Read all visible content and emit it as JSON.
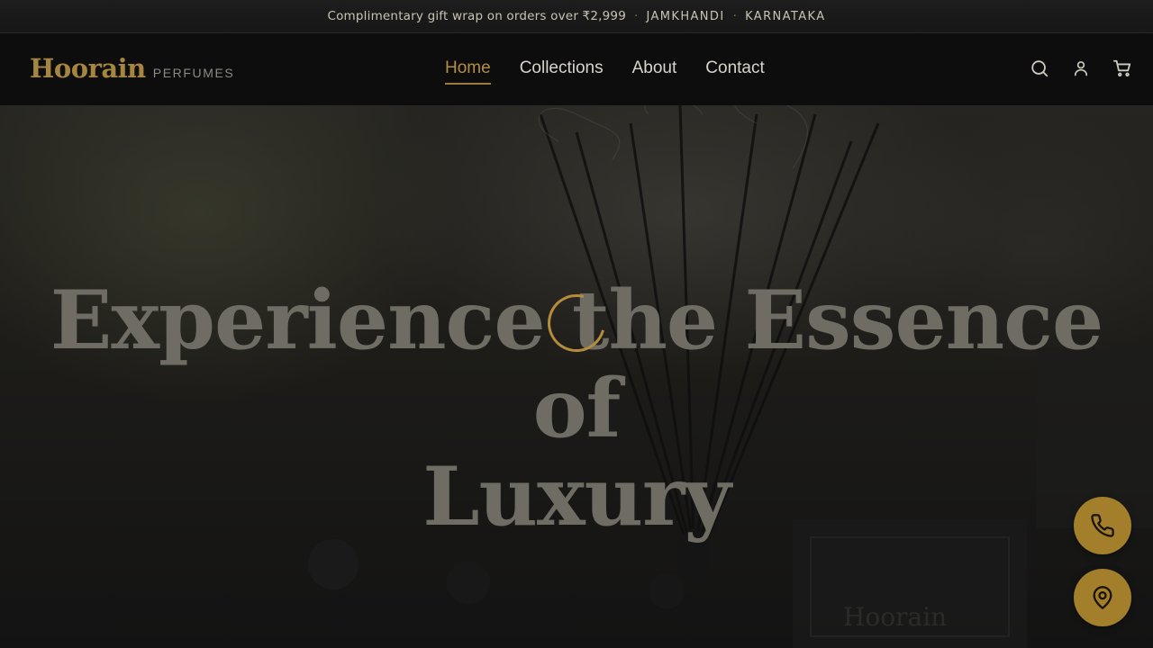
{
  "announcement": {
    "offer": "Complimentary gift wrap on orders over ₹2,999",
    "separator": "·",
    "city": "JAMKHANDI",
    "state": "KARNATAKA"
  },
  "brand": {
    "name": "Hoorain",
    "subtitle": "PERFUMES",
    "color": "#a5853f"
  },
  "nav": {
    "items": [
      {
        "label": "Home",
        "active": true
      },
      {
        "label": "Collections",
        "active": false
      },
      {
        "label": "About",
        "active": false
      },
      {
        "label": "Contact",
        "active": false
      }
    ]
  },
  "header_icons": [
    "search-icon",
    "account-icon",
    "cart-icon"
  ],
  "hero": {
    "headline_line1": "Experience the Essence of",
    "headline_line2": "Luxury",
    "watermark": "Hoorain",
    "loading": true
  },
  "floating_actions": [
    "phone-icon",
    "map-pin-icon"
  ],
  "colors": {
    "accent": "#a37f2b",
    "active_nav": "#b38e44",
    "background": "#0c0c0c"
  }
}
